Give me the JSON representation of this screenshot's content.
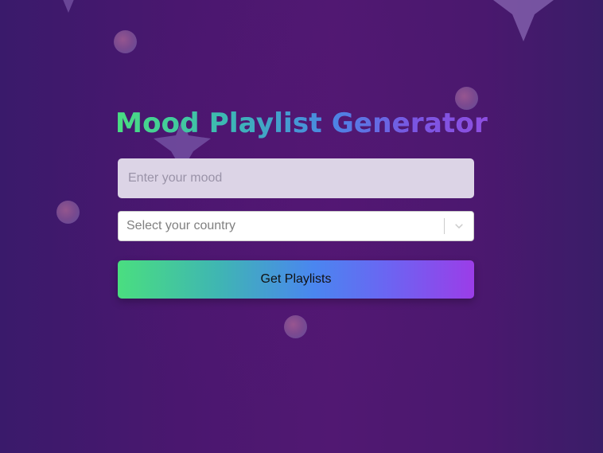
{
  "app": {
    "title": "Mood Playlist Generator"
  },
  "form": {
    "mood_placeholder": "Enter your mood",
    "mood_value": "",
    "country_placeholder": "Select your country",
    "submit_label": "Get Playlists"
  },
  "colors": {
    "background": "#4a176f",
    "title_gradient_start": "#4ade80",
    "title_gradient_end": "#8e4ee0",
    "button_gradient_start": "#4ade80",
    "button_gradient_end": "#9b3de8",
    "input_background": "#dcd4e6"
  },
  "icons": {
    "select_indicator": "chevron-down-icon"
  }
}
